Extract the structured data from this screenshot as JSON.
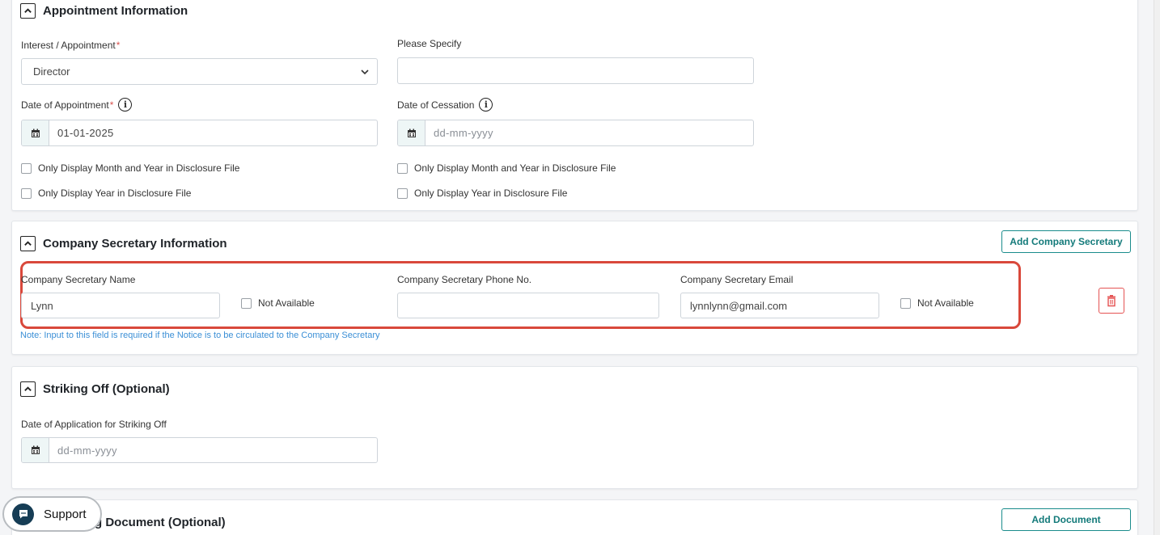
{
  "appointment": {
    "title": "Appointment Information",
    "interest_label": "Interest / Appointment",
    "required_mark": "*",
    "interest_value": "Director",
    "specify_label": "Please Specify",
    "specify_value": "",
    "date_appointment_label": "Date of Appointment",
    "date_appointment_value": "01-01-2025",
    "date_cessation_label": "Date of Cessation",
    "date_cessation_placeholder": "dd-mm-yyyy",
    "info_glyph": "i",
    "checkbox_month_year": "Only Display Month and Year in Disclosure File",
    "checkbox_year": "Only Display Year in Disclosure File"
  },
  "secretary": {
    "title": "Company Secretary Information",
    "add_button": "Add Company Secretary",
    "name_label": "Company Secretary Name",
    "name_value": "Lynn",
    "name_not_available": "Not Available",
    "phone_label": "Company Secretary Phone No.",
    "phone_value": "",
    "email_label": "Company Secretary Email",
    "email_value": "lynnlynn@gmail.com",
    "email_not_available": "Not Available",
    "note": "Note: Input to this field is required if the Notice is to be circulated to the Company Secretary"
  },
  "striking": {
    "title": "Striking Off (Optional)",
    "date_label": "Date of Application for Striking Off",
    "date_placeholder": "dd-mm-yyyy"
  },
  "supporting": {
    "title_partial": "g Document (Optional)",
    "add_button": "Add Document"
  },
  "support_widget": {
    "label": "Support"
  },
  "icons": {
    "collapse": "chevron-up-icon",
    "calendar": "calendar-icon",
    "info": "info-icon",
    "trash": "trash-icon",
    "support": "chat-icon",
    "select": "chevron-down-icon"
  },
  "colors": {
    "accent": "#1a8c8c",
    "required": "#d9534f",
    "highlight": "#d9483b",
    "note": "#3b8fd6",
    "delete": "#e55353"
  }
}
